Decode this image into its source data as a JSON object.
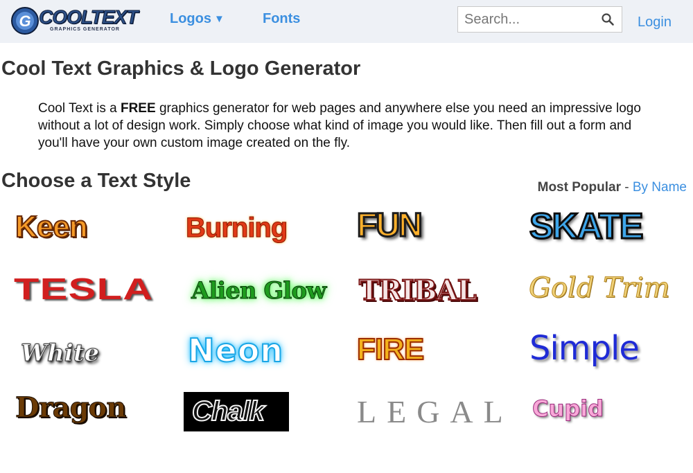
{
  "header": {
    "logo_text": "COOLTEXT",
    "logo_tagline": "GRAPHICS GENERATOR",
    "nav": {
      "logos": "Logos",
      "logos_arrow": "▼",
      "fonts": "Fonts"
    },
    "search_placeholder": "Search...",
    "search_icon": "search-icon",
    "login": "Login"
  },
  "page": {
    "title": "Cool Text Graphics & Logo Generator",
    "intro_before": "Cool Text is a ",
    "intro_bold": "FREE",
    "intro_after": " graphics generator for web pages and anywhere else you need an impressive logo without a lot of design work. Simply choose what kind of image you would like. Then fill out a form and you'll have your own custom image created on the fly."
  },
  "styles_section": {
    "title": "Choose a Text Style",
    "sort_active": "Most Popular",
    "sort_separator": " - ",
    "sort_link": "By Name",
    "items": [
      "Keen",
      "Burning",
      "FUN",
      "SKATE",
      "TESLA",
      "Alien Glow",
      "TRIBAL",
      "Gold Trim",
      "White",
      "Neon",
      "FIRE",
      "Simple",
      "Dragon",
      "Chalk",
      "LEGAL",
      "Cupid"
    ]
  },
  "colors": {
    "link": "#3b8fe0",
    "header_bg": "#eef1f6"
  }
}
